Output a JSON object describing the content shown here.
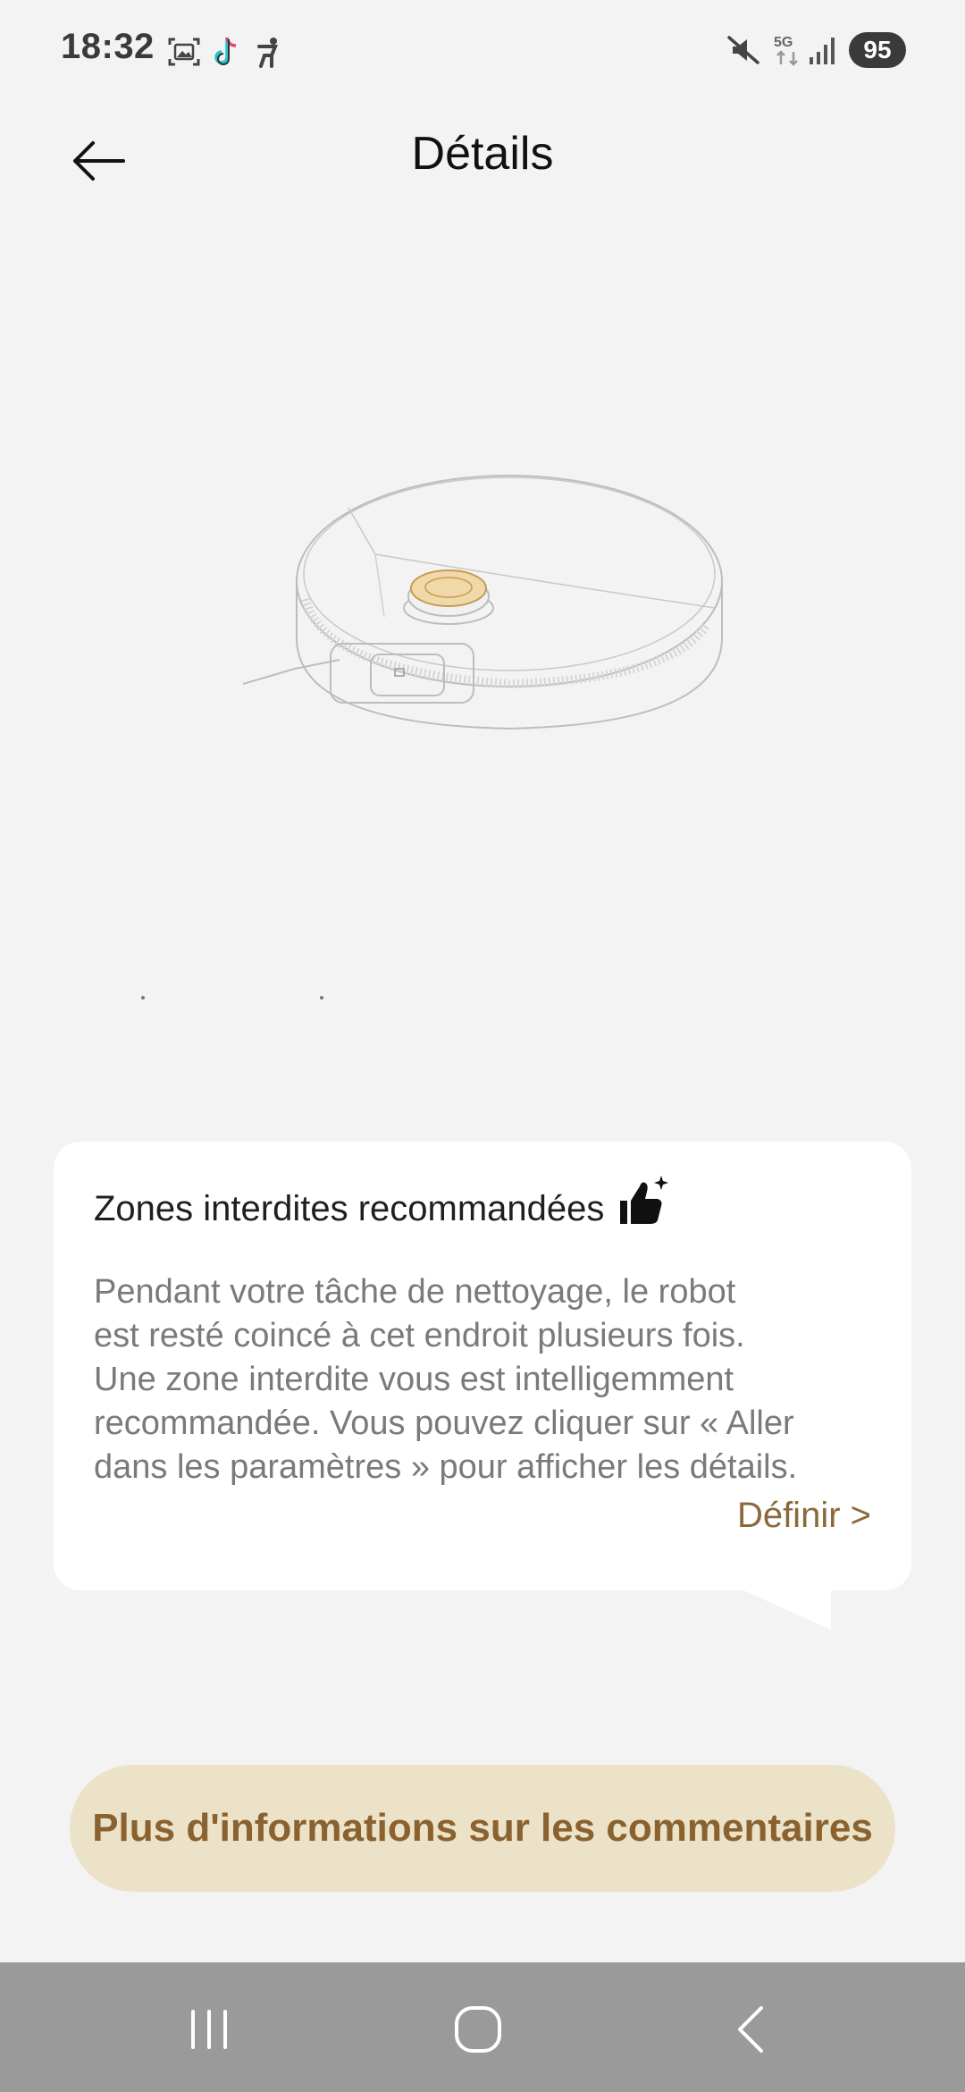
{
  "status_bar": {
    "time": "18:32",
    "left_icons": [
      "screenshot-icon",
      "tiktok-icon",
      "accessibility-icon"
    ],
    "right_icons": [
      "mute-icon",
      "5g-icon",
      "signal-icon"
    ],
    "network_label": "5G",
    "battery": "95"
  },
  "header": {
    "title": "Détails",
    "back_icon": "arrow-left-icon"
  },
  "card": {
    "title": "Zones interdites recommandées",
    "title_icon": "thumbs-up-sparkle-icon",
    "body_lines": [
      "Pendant votre tâche de nettoyage, le robot",
      "est resté coincé à cet endroit plusieurs fois.",
      "Une zone interdite vous est intelligemment",
      "recommandée. Vous pouvez cliquer sur « Aller",
      "dans les paramètres » pour afficher les détails."
    ],
    "link": "Définir >"
  },
  "primary_button": {
    "label": "Plus d'informations sur les commentaires"
  },
  "nav_bar": {
    "items": [
      "recents-icon",
      "home-icon",
      "back-icon"
    ]
  },
  "colors": {
    "background": "#f3f3f3",
    "card": "#ffffff",
    "accent_text": "#8a6230",
    "button_bg": "#ebe2c8",
    "nav_bg": "#9a9a9a"
  }
}
